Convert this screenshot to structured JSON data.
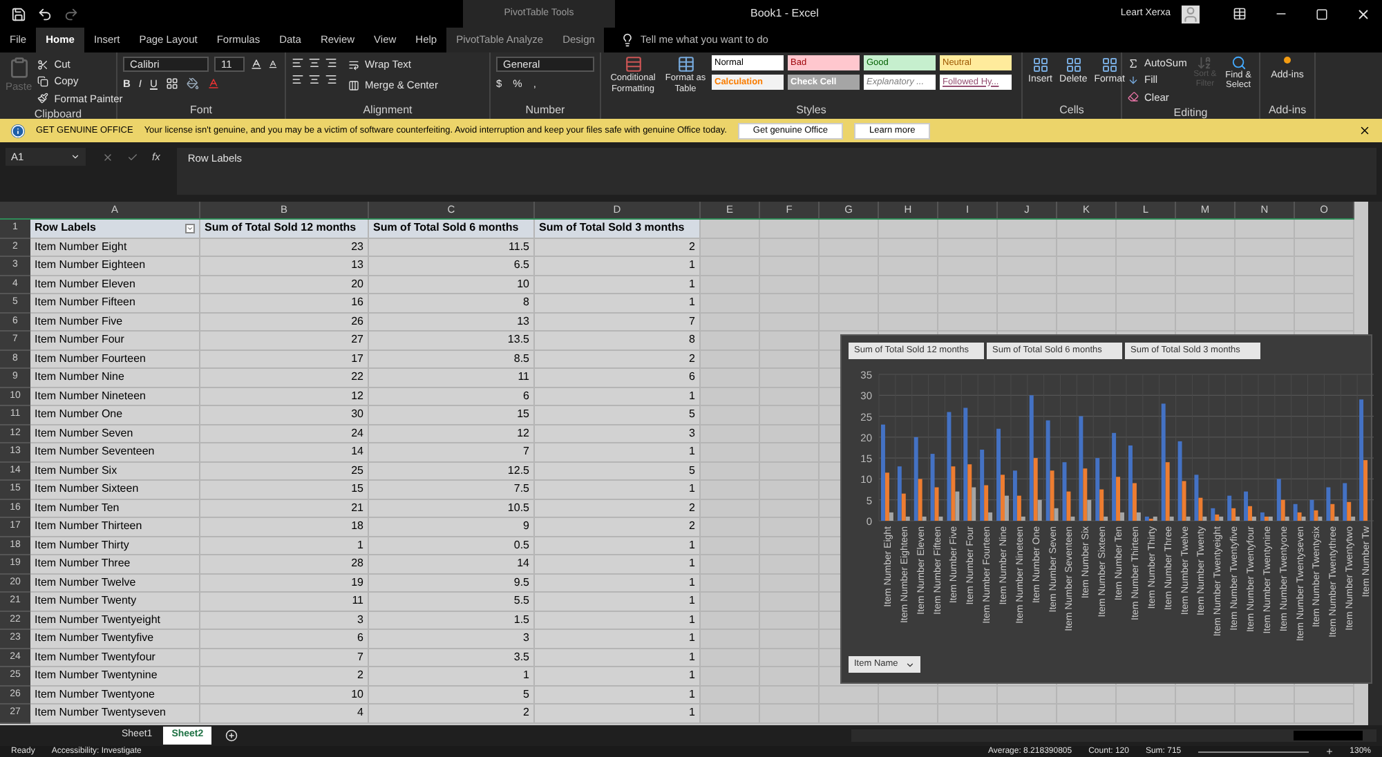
{
  "title_bar": {
    "title": "Book1 - Excel",
    "context_label": "PivotTable Tools",
    "user_name": "Leart Xerxa"
  },
  "tabs": [
    {
      "label": "File",
      "selected": false,
      "kind": "main"
    },
    {
      "label": "Home",
      "selected": true,
      "kind": "main"
    },
    {
      "label": "Insert",
      "selected": false,
      "kind": "main"
    },
    {
      "label": "Page Layout",
      "selected": false,
      "kind": "main"
    },
    {
      "label": "Formulas",
      "selected": false,
      "kind": "main"
    },
    {
      "label": "Data",
      "selected": false,
      "kind": "main"
    },
    {
      "label": "Review",
      "selected": false,
      "kind": "main"
    },
    {
      "label": "View",
      "selected": false,
      "kind": "main"
    },
    {
      "label": "Help",
      "selected": false,
      "kind": "main"
    },
    {
      "label": "PivotTable Analyze",
      "selected": false,
      "kind": "context"
    },
    {
      "label": "Design",
      "selected": false,
      "kind": "context"
    }
  ],
  "tell_me": {
    "placeholder": "Tell me what you want to do"
  },
  "ribbon": {
    "clipboard": {
      "label": "Clipboard",
      "paste": {
        "label": "Paste",
        "disabled": true
      },
      "cut": "Cut",
      "copy": "Copy",
      "format_painter": "Format Painter"
    },
    "font": {
      "label": "Font",
      "font_name": "Calibri",
      "font_size": "11",
      "bold": "B",
      "italic": "I",
      "underline": "U"
    },
    "alignment": {
      "label": "Alignment",
      "wrap_text": "Wrap Text",
      "merge": "Merge & Center"
    },
    "number": {
      "label": "Number",
      "format": "General",
      "currency": "$",
      "percent": "%",
      "comma": ","
    },
    "styles": {
      "label": "Styles",
      "conditional": "Conditional Formatting",
      "format_table": "Format as Table",
      "cell_styles": [
        {
          "label": "Normal",
          "kind": "normal"
        },
        {
          "label": "Bad",
          "kind": "bad"
        },
        {
          "label": "Good",
          "kind": "good"
        },
        {
          "label": "Neutral",
          "kind": "neutral"
        },
        {
          "label": "Calculation",
          "kind": "calculation"
        },
        {
          "label": "Check Cell",
          "kind": "check"
        },
        {
          "label": "Explanatory ...",
          "kind": "explanatory"
        },
        {
          "label": "Followed Hy...",
          "kind": "followed"
        }
      ]
    },
    "cells": {
      "label": "Cells",
      "buttons": [
        "Insert",
        "Delete",
        "Format"
      ]
    },
    "editing": {
      "label": "Editing",
      "autosum": "AutoSum",
      "fill": "Fill",
      "clear": "Clear",
      "sort_filter": {
        "label": "Sort & Filter",
        "disabled": true
      },
      "find_select": "Find & Select"
    },
    "addins": {
      "label": "Add-ins",
      "button": "Add-ins"
    }
  },
  "message_bar": {
    "title": "GET GENUINE OFFICE",
    "text": "Your license isn't genuine, and you may be a victim of software counterfeiting. Avoid interruption and keep your files safe with genuine Office today.",
    "buttons": [
      "Get genuine Office",
      "Learn more"
    ]
  },
  "formula_bar": {
    "name_box": "A1",
    "function_label": "fx",
    "formula": "Row Labels"
  },
  "sheet": {
    "columns": [
      "A",
      "B",
      "C",
      "D",
      "E",
      "F",
      "G",
      "H",
      "I",
      "J",
      "K",
      "L",
      "M",
      "N",
      "O"
    ],
    "header": {
      "number": "1",
      "cells": [
        "Row Labels",
        "Sum of Total Sold 12 months",
        "Sum of Total Sold 6 months",
        "Sum of Total Sold 3 months"
      ]
    },
    "rows": [
      {
        "number": "2",
        "cells": [
          "Item Number Eight",
          "23",
          "11.5",
          "2"
        ]
      },
      {
        "number": "3",
        "cells": [
          "Item Number Eighteen",
          "13",
          "6.5",
          "1"
        ]
      },
      {
        "number": "4",
        "cells": [
          "Item Number Eleven",
          "20",
          "10",
          "1"
        ]
      },
      {
        "number": "5",
        "cells": [
          "Item Number Fifteen",
          "16",
          "8",
          "1"
        ]
      },
      {
        "number": "6",
        "cells": [
          "Item Number Five",
          "26",
          "13",
          "7"
        ]
      },
      {
        "number": "7",
        "cells": [
          "Item Number Four",
          "27",
          "13.5",
          "8"
        ]
      },
      {
        "number": "8",
        "cells": [
          "Item Number Fourteen",
          "17",
          "8.5",
          "2"
        ]
      },
      {
        "number": "9",
        "cells": [
          "Item Number Nine",
          "22",
          "11",
          "6"
        ]
      },
      {
        "number": "10",
        "cells": [
          "Item Number Nineteen",
          "12",
          "6",
          "1"
        ]
      },
      {
        "number": "11",
        "cells": [
          "Item Number One",
          "30",
          "15",
          "5"
        ]
      },
      {
        "number": "12",
        "cells": [
          "Item Number Seven",
          "24",
          "12",
          "3"
        ]
      },
      {
        "number": "13",
        "cells": [
          "Item Number Seventeen",
          "14",
          "7",
          "1"
        ]
      },
      {
        "number": "14",
        "cells": [
          "Item Number Six",
          "25",
          "12.5",
          "5"
        ]
      },
      {
        "number": "15",
        "cells": [
          "Item Number Sixteen",
          "15",
          "7.5",
          "1"
        ]
      },
      {
        "number": "16",
        "cells": [
          "Item Number Ten",
          "21",
          "10.5",
          "2"
        ]
      },
      {
        "number": "17",
        "cells": [
          "Item Number Thirteen",
          "18",
          "9",
          "2"
        ]
      },
      {
        "number": "18",
        "cells": [
          "Item Number Thirty",
          "1",
          "0.5",
          "1"
        ]
      },
      {
        "number": "19",
        "cells": [
          "Item Number Three",
          "28",
          "14",
          "1"
        ]
      },
      {
        "number": "20",
        "cells": [
          "Item Number Twelve",
          "19",
          "9.5",
          "1"
        ]
      },
      {
        "number": "21",
        "cells": [
          "Item Number Twenty",
          "11",
          "5.5",
          "1"
        ]
      },
      {
        "number": "22",
        "cells": [
          "Item Number Twentyeight",
          "3",
          "1.5",
          "1"
        ]
      },
      {
        "number": "23",
        "cells": [
          "Item Number Twentyfive",
          "6",
          "3",
          "1"
        ]
      },
      {
        "number": "24",
        "cells": [
          "Item Number Twentyfour",
          "7",
          "3.5",
          "1"
        ]
      },
      {
        "number": "25",
        "cells": [
          "Item Number Twentynine",
          "2",
          "1",
          "1"
        ]
      },
      {
        "number": "26",
        "cells": [
          "Item Number Twentyone",
          "10",
          "5",
          "1"
        ]
      },
      {
        "number": "27",
        "cells": [
          "Item Number Twentyseven",
          "4",
          "2",
          "1"
        ]
      }
    ]
  },
  "chart": {
    "field_button": "Item Name",
    "chart_data": {
      "type": "bar",
      "grid": true,
      "ylim": [
        0,
        35
      ],
      "yticks": [
        0,
        5,
        10,
        15,
        20,
        25,
        30,
        35
      ],
      "categories": [
        "Item Number Eight",
        "Item Number Eighteen",
        "Item Number Eleven",
        "Item Number Fifteen",
        "Item Number Five",
        "Item Number Four",
        "Item Number Fourteen",
        "Item Number Nine",
        "Item Number Nineteen",
        "Item Number One",
        "Item Number Seven",
        "Item Number Seventeen",
        "Item Number Six",
        "Item Number Sixteen",
        "Item Number Ten",
        "Item Number Thirteen",
        "Item Number Thirty",
        "Item Number Three",
        "Item Number Twelve",
        "Item Number Twenty",
        "Item Number Twentyeight",
        "Item Number Twentyfive",
        "Item Number Twentyfour",
        "Item Number Twentynine",
        "Item Number Twentyone",
        "Item Number Twentyseven",
        "Item Number Twentysix",
        "Item Number Twentythree",
        "Item Number Twentytwo",
        "Item Number Tw"
      ],
      "series": [
        {
          "name": "Sum of Total Sold 12 months",
          "color": "#4472c4",
          "values": [
            23,
            13,
            20,
            16,
            26,
            27,
            17,
            22,
            12,
            30,
            24,
            14,
            25,
            15,
            21,
            18,
            1,
            28,
            19,
            11,
            3,
            6,
            7,
            2,
            10,
            4,
            5,
            8,
            9,
            29
          ]
        },
        {
          "name": "Sum of Total Sold 6 months",
          "color": "#ed7d31",
          "values": [
            11.5,
            6.5,
            10,
            8,
            13,
            13.5,
            8.5,
            11,
            6,
            15,
            12,
            7,
            12.5,
            7.5,
            10.5,
            9,
            0.5,
            14,
            9.5,
            5.5,
            1.5,
            3,
            3.5,
            1,
            5,
            2,
            2.5,
            4,
            4.5,
            14.5
          ]
        },
        {
          "name": "Sum of Total Sold 3 months",
          "color": "#a5a5a5",
          "values": [
            2,
            1,
            1,
            1,
            7,
            8,
            2,
            6,
            1,
            5,
            3,
            1,
            5,
            1,
            2,
            2,
            1,
            1,
            1,
            1,
            1,
            1,
            1,
            1,
            1,
            1,
            1,
            1,
            1,
            null
          ]
        }
      ]
    }
  },
  "sheet_tabs": [
    {
      "label": "Sheet1",
      "selected": false
    },
    {
      "label": "Sheet2",
      "selected": true
    }
  ],
  "status_bar": {
    "mode": "Ready",
    "accessibility": "Accessibility: Investigate",
    "average": "Average: 8.218390805",
    "count": "Count: 120",
    "sum": "Sum: 715",
    "zoom": "130%"
  }
}
